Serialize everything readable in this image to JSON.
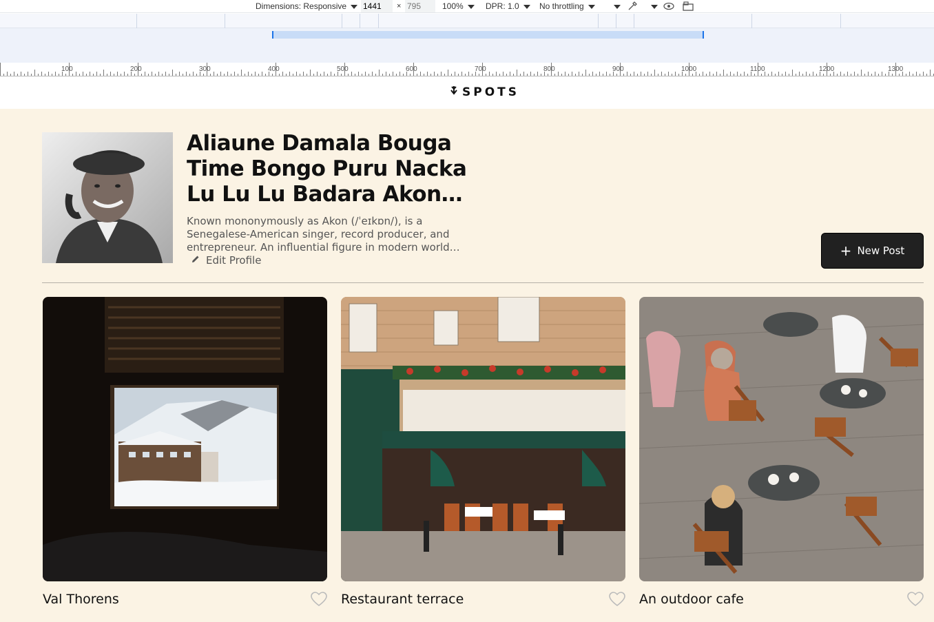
{
  "devtools": {
    "dimensions_label": "Dimensions: Responsive",
    "width_value": "1441",
    "height_placeholder": "795",
    "times": "×",
    "zoom": "100%",
    "dpr": "DPR: 1.0",
    "throttling": "No throttling"
  },
  "ruler": {
    "labels": [
      "100",
      "200",
      "300",
      "400",
      "500",
      "600",
      "700",
      "800",
      "900",
      "1000",
      "1100",
      "1200",
      "1300"
    ]
  },
  "header": {
    "logo_text": "SPOTS"
  },
  "profile": {
    "name": "Aliaune Damala Bouga Time Bongo Puru Nacka Lu Lu Lu Badara Akon…",
    "bio": "Known mononymously as Akon (/ˈeɪkɒn/), is a Senegalese-American singer, record producer, and entrepreneur. An influential figure in modern world…",
    "edit_label": "Edit Profile"
  },
  "actions": {
    "new_post_label": "New Post"
  },
  "cards": [
    {
      "title": "Val Thorens",
      "liked": false
    },
    {
      "title": "Restaurant terrace",
      "liked": false
    },
    {
      "title": "An outdoor cafe",
      "liked": false
    }
  ],
  "colors": {
    "page_bg": "#fbf3e4",
    "button_bg": "#212121",
    "accent_blue": "#1a73e8"
  }
}
